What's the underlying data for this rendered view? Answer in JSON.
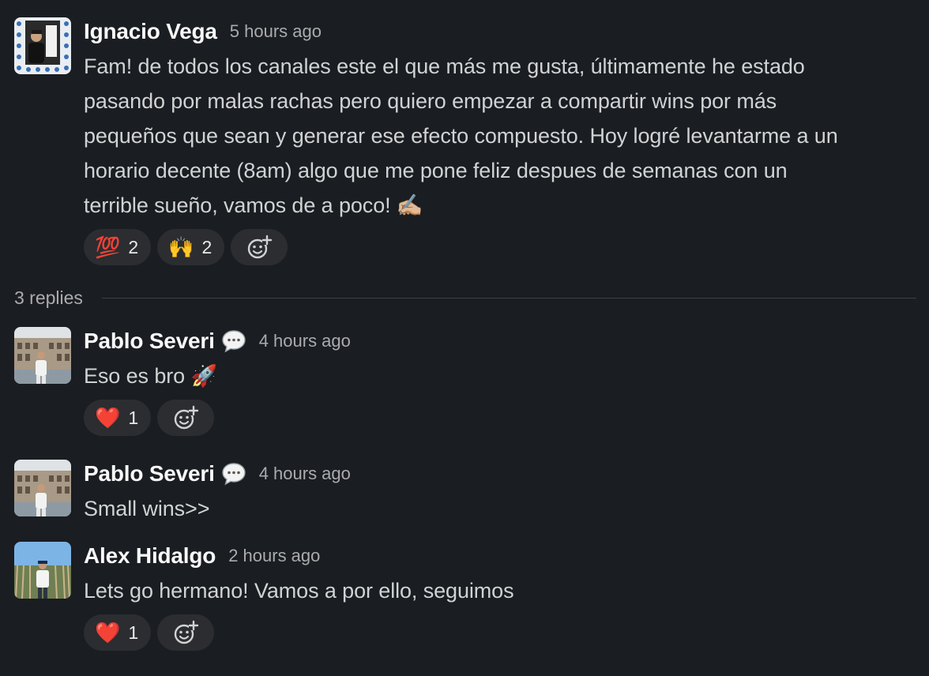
{
  "messages": [
    {
      "author": "Ignacio Vega",
      "time": "5 hours ago",
      "text_lines": [
        "Fam! de todos los canales este el que más me gusta, últimamente he estado",
        "pasando por malas rachas pero quiero empezar a compartir wins por más",
        "pequeños que sean y generar ese efecto compuesto. Hoy logré levantarme a un",
        "horario decente (8am) algo que me pone feliz despues de semanas con un",
        "terrible sueño, vamos de a poco! ✍🏼"
      ],
      "reactions": [
        {
          "emoji": "💯",
          "count": "2"
        },
        {
          "emoji": "🙌",
          "count": "2"
        }
      ]
    },
    {
      "author": "Pablo Severi",
      "time": "4 hours ago",
      "text": "Eso es bro 🚀",
      "reactions": [
        {
          "emoji": "❤️",
          "count": "1"
        }
      ]
    },
    {
      "author": "Pablo Severi",
      "time": "4 hours ago",
      "text": "Small wins>>"
    },
    {
      "author": "Alex Hidalgo",
      "time": "2 hours ago",
      "text": "Lets go hermano! Vamos a por ello, seguimos",
      "reactions": [
        {
          "emoji": "❤️",
          "count": "1"
        }
      ]
    }
  ],
  "replies_label": "3 replies",
  "icons": {
    "add_reaction": "add-reaction-icon",
    "thread": "speech-bubble-icon"
  },
  "colors": {
    "background": "#1a1d21",
    "pill": "#2b2d31",
    "name": "#f8f8f8",
    "text": "#d1d2d3",
    "muted": "#ababad"
  }
}
